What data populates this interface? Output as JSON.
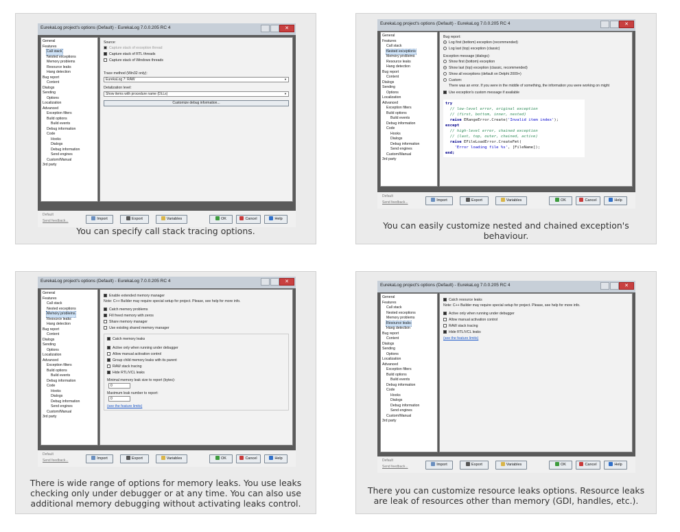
{
  "window_title": "EurekaLog project's options (Default) - EurekaLog 7.0.0.205 RC 4",
  "tree": [
    {
      "label": "General",
      "level": 0
    },
    {
      "label": "Features",
      "level": 0
    },
    {
      "label": "Call stack",
      "level": 1
    },
    {
      "label": "Nested exceptions",
      "level": 1
    },
    {
      "label": "Memory problems",
      "level": 1
    },
    {
      "label": "Resource leaks",
      "level": 1
    },
    {
      "label": "Hang detection",
      "level": 1
    },
    {
      "label": "Bug report",
      "level": 0
    },
    {
      "label": "Content",
      "level": 1
    },
    {
      "label": "Dialogs",
      "level": 0
    },
    {
      "label": "Sending",
      "level": 0
    },
    {
      "label": "Options",
      "level": 1
    },
    {
      "label": "Localization",
      "level": 0
    },
    {
      "label": "Advanced",
      "level": 0
    },
    {
      "label": "Exception filters",
      "level": 1
    },
    {
      "label": "Build options",
      "level": 1
    },
    {
      "label": "Build events",
      "level": 2
    },
    {
      "label": "Debug information",
      "level": 1
    },
    {
      "label": "Code",
      "level": 1
    },
    {
      "label": "Hooks",
      "level": 2
    },
    {
      "label": "Dialogs",
      "level": 2
    },
    {
      "label": "Debug information",
      "level": 2
    },
    {
      "label": "Send engines",
      "level": 2
    },
    {
      "label": "Custom/Manual",
      "level": 1
    },
    {
      "label": "3rd party",
      "level": 0
    }
  ],
  "footer": {
    "default_label": "Default",
    "send_feedback": "Send feedback...",
    "import": "Import",
    "export": "Export",
    "variables": "Variables",
    "ok": "OK",
    "cancel": "Cancel",
    "help": "Help"
  },
  "cards": [
    {
      "caption": "You can specify call stack tracing options.",
      "selected": 2,
      "source_label": "Source:",
      "source_opts": [
        "Capture stack of exception thread",
        "Capture stack of RTL threads",
        "Capture stack of Windows threads"
      ],
      "trace_label": "Trace method (Win32 only):",
      "trace_value": "EurekaLog 7: RAW",
      "detail_label": "Detalization level:",
      "detail_value": "Show items with procedure name (DLLs)",
      "customize_btn": "Customize debug information..."
    },
    {
      "caption": "You can easily customize nested and chained exception's behaviour.",
      "selected": 3,
      "bug_report_label": "Bug report:",
      "bug_opts": [
        "Log first (bottom) exception (recommended)",
        "Log last (top) exception (classic)"
      ],
      "msg_label": "Exception message (dialogs):",
      "msg_opts": [
        "Show first (bottom) exception",
        "Show last (top) exception (classic, recommended)",
        "Show all exceptions (default on Delphi 2009+)",
        "Custom:"
      ],
      "custom_text": "There was an error. If you were in the middle of something, the information you were working on might",
      "use_custom": "Use exception's custom message if available",
      "code": {
        "l1": "try",
        "l2": "  // low-level error, original exception",
        "l3": "  // (first, bottom, inner, nested)",
        "l4a": "  raise ",
        "l4b": "ERangeError.Create(",
        "l4c": "'Invalid item index'",
        "l4d": ");",
        "l5": "except",
        "l6": "  // high-level error, chained exception",
        "l7": "  // (last, top, outer, chained, active)",
        "l8a": "  raise ",
        "l8b": "EFileLoadError.CreateFmt(",
        "l9a": "    ",
        "l9b": "'Error loading file %s'",
        "l9c": ", [FileName]);",
        "l10": "end;"
      }
    },
    {
      "caption": "There is wide range of options for memory leaks. You use leaks checking only under debugger or at any time. You can also use additional memory debugging without activating leaks control.",
      "selected": 4,
      "enable": "Enable extended memory manager",
      "note": "Note: C++ Builder may require special setup for project. Please, see help for more info.",
      "opts1": [
        "Catch memory problems",
        "Fill freed memory with zeros",
        "Share memory manager",
        "Use existing shared memory manager"
      ],
      "catch_leaks": "Catch memory leaks",
      "opts2": [
        "Active only when running under debugger",
        "Allow manual activation control",
        "Group child memory leaks with its parent",
        "RAW stack tracing",
        "Hide RTL/VCL leaks"
      ],
      "minimal_label": "Minimal memory leak size to report (bytes):",
      "minimal_value": "0",
      "maximum_label": "Maximum leak number to report:",
      "maximum_value": "0",
      "limits": "(see the feature limits)"
    },
    {
      "caption": "There you can customize resource leaks options. Resource leaks are leak of resources other than memory (GDI, handles, etc.).",
      "selected": 5,
      "catch": "Catch resource leaks",
      "note": "Note: C++ Builder may require special setup for project. Please, see help for more info.",
      "opts": [
        "Active only when running under debugger",
        "Allow manual activation control",
        "RAW stack tracing",
        "Hide RTL/VCL leaks"
      ],
      "limits": "(see the feature limits)"
    }
  ]
}
